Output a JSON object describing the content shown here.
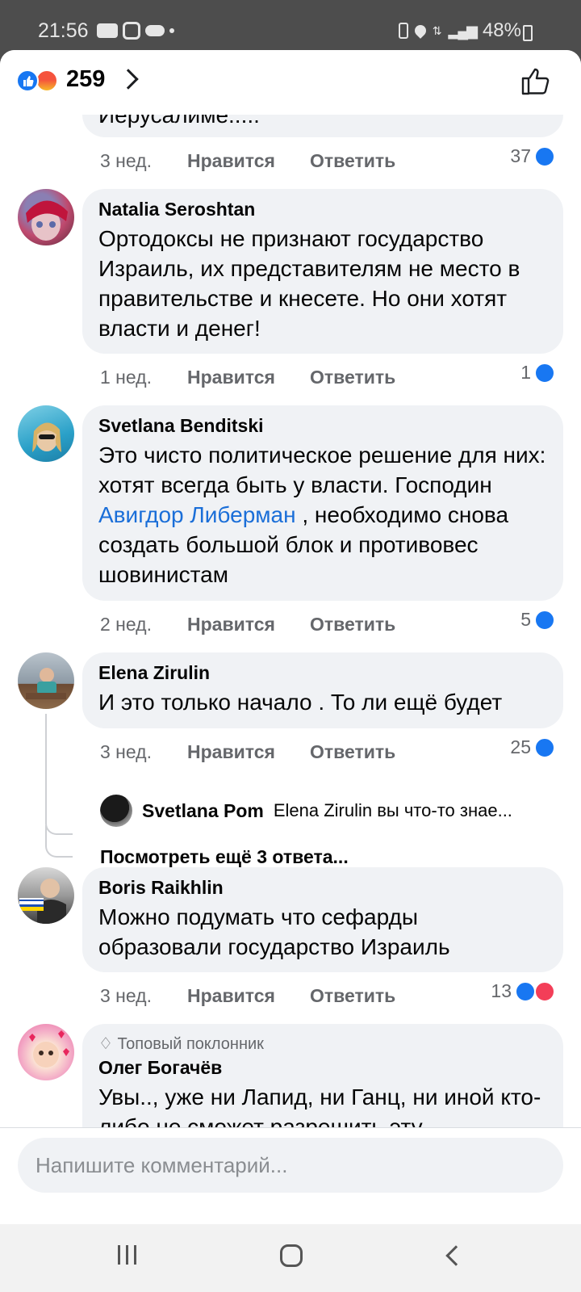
{
  "status_bar": {
    "time": "21:56",
    "battery": "48%"
  },
  "header": {
    "reaction_count": "259"
  },
  "colors": {
    "like_blue": "#1877f2",
    "link_blue": "#1a6ed8",
    "bubble_gray": "#f0f2f5",
    "heart_red": "#f33e58"
  },
  "comments": [
    {
      "partial_text": "Иерусалиме.....",
      "time": "3 нед.",
      "like_label": "Нравится",
      "reply_label": "Ответить",
      "reactions": "37"
    },
    {
      "author": "Natalia Seroshtan",
      "text": "Ортодоксы не признают государство Израиль, их представителям не место в правительстве и кнесете. Но они хотят власти и денег!",
      "time": "1 нед.",
      "like_label": "Нравится",
      "reply_label": "Ответить",
      "reactions": "1"
    },
    {
      "author": "Svetlana Benditski",
      "text_before": "Это чисто политическое решение для них: хотят всегда быть у власти. Господин ",
      "mention": "Авигдор Либерман",
      "text_after": " , необходимо снова создать большой блок и противовес шовинистам",
      "time": "2 нед.",
      "like_label": "Нравится",
      "reply_label": "Ответить",
      "reactions": "5"
    },
    {
      "author": "Elena Zirulin",
      "text": "И это только начало . То ли ещё будет",
      "time": "3 нед.",
      "like_label": "Нравится",
      "reply_label": "Ответить",
      "reactions": "25",
      "reply_preview": {
        "author": "Svetlana Pom",
        "text": "Elena Zirulin вы что-то знае..."
      },
      "more_replies": "Посмотреть ещё 3 ответа..."
    },
    {
      "author": "Boris Raikhlin",
      "text": "Можно подумать что сефарды образовали государство Израиль",
      "time": "3 нед.",
      "like_label": "Нравится",
      "reply_label": "Ответить",
      "reactions": "13"
    },
    {
      "badge": "Топовый поклонник",
      "author": "Олег Богачёв",
      "text": "Увы.., уже ни Лапид, ни Ганц, ни иной кто-либо не сможет разрешить эту"
    }
  ],
  "composer": {
    "placeholder": "Напишите комментарий..."
  }
}
